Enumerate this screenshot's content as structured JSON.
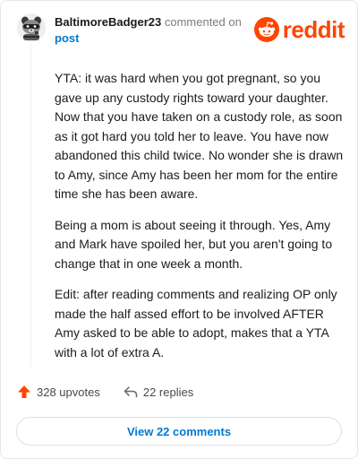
{
  "comment": {
    "username": "BaltimoreBadger23",
    "action_text": "commented on",
    "post_link": "post"
  },
  "brand": {
    "name": "reddit",
    "color": "#ff4500"
  },
  "body": {
    "paragraphs": [
      "YTA: it was hard when you got pregnant, so you gave up any custody rights toward your daughter. Now that you have taken on a custody role, as soon as it got hard you told her to leave. You have now abandoned this child twice. No wonder she is drawn to Amy, since Amy has been her mom for the entire time she has been aware.",
      "Being a mom is about seeing it through. Yes, Amy and Mark have spoiled her, but you aren't going to change that in one week a month.",
      "Edit: after reading comments and realizing OP only made the half assed effort to be involved AFTER Amy asked to be able to adopt, makes that a YTA with a lot of extra A."
    ]
  },
  "actions": {
    "upvotes": "328 upvotes",
    "replies": "22 replies",
    "view_comments": "View 22 comments"
  },
  "icons": {
    "avatar": "raccoon-avatar",
    "upvote": "upvote-arrow-icon",
    "reply": "reply-arrow-icon",
    "logo": "reddit-snoo-icon"
  },
  "colors": {
    "upvote": "#ff4500",
    "link": "#0079d3"
  }
}
